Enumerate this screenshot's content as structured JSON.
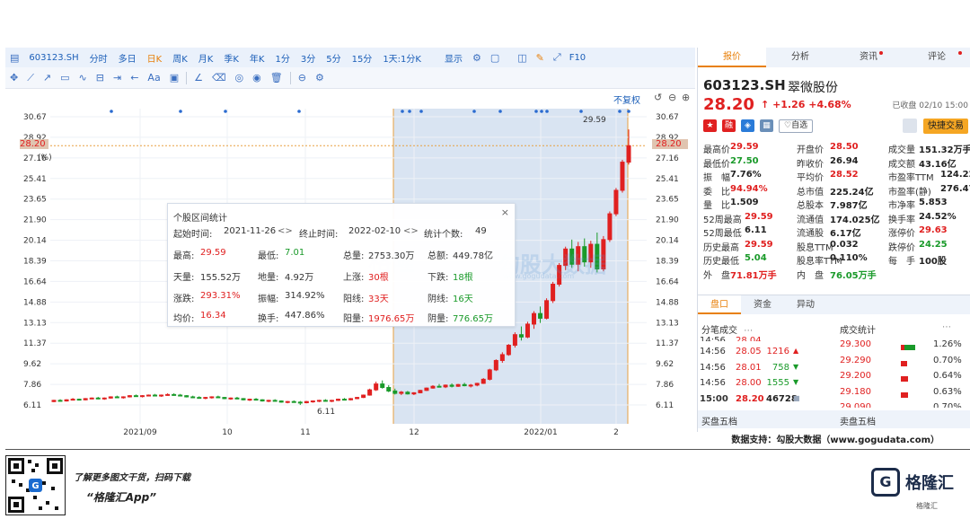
{
  "toolbar": {
    "code": "603123.SH",
    "periods": [
      "分时",
      "多日",
      "日K",
      "周K",
      "月K",
      "季K",
      "年K",
      "1分",
      "3分",
      "5分",
      "15分",
      "1天:1分K"
    ],
    "active_period": "日K",
    "display_label": "显示",
    "f10_label": "F10",
    "draw_tools": [
      "move",
      "line",
      "ray",
      "rect",
      "wave",
      "split",
      "arrow",
      "text",
      "note",
      "erase",
      "measure",
      "circle",
      "time",
      "delete",
      "pair",
      "settings"
    ]
  },
  "chart": {
    "adjust_label": "不复权",
    "y_ticks": [
      "30.67",
      "28.92",
      "27.16",
      "25.41",
      "23.65",
      "21.90",
      "20.14",
      "18.39",
      "16.64",
      "14.88",
      "13.13",
      "11.37",
      "9.62",
      "7.86",
      "6.11"
    ],
    "current_price_left": "28.20",
    "current_price_right": "28.20",
    "ma_label": "(%)",
    "max_label": "29.59",
    "min_label": "6.11",
    "x_labels": [
      "2021/09",
      "10",
      "11",
      "12",
      "2022/01",
      "2"
    ]
  },
  "chart_data": {
    "type": "candlestick",
    "title": "",
    "xlabel": "",
    "ylabel": "",
    "ylim": [
      6.11,
      30.67
    ],
    "x_ticks": [
      "2021/09",
      "10",
      "11",
      "12",
      "2022/01",
      "2"
    ],
    "series": [
      {
        "ohlc": [
          [
            6.4,
            6.55,
            6.35,
            6.5
          ],
          [
            6.5,
            6.6,
            6.4,
            6.45
          ],
          [
            6.45,
            6.6,
            6.4,
            6.55
          ],
          [
            6.55,
            6.7,
            6.5,
            6.6
          ],
          [
            6.6,
            6.65,
            6.5,
            6.55
          ],
          [
            6.55,
            6.7,
            6.5,
            6.65
          ],
          [
            6.65,
            6.75,
            6.6,
            6.7
          ],
          [
            6.7,
            6.8,
            6.6,
            6.65
          ],
          [
            6.65,
            6.75,
            6.55,
            6.7
          ],
          [
            6.7,
            6.85,
            6.65,
            6.8
          ],
          [
            6.8,
            6.9,
            6.7,
            6.75
          ],
          [
            6.75,
            6.85,
            6.65,
            6.8
          ],
          [
            6.8,
            6.95,
            6.75,
            6.9
          ],
          [
            6.9,
            7.0,
            6.8,
            6.85
          ],
          [
            6.85,
            6.95,
            6.75,
            6.9
          ],
          [
            6.9,
            7.0,
            6.85,
            6.95
          ],
          [
            6.95,
            7.05,
            6.85,
            6.9
          ],
          [
            6.9,
            7.0,
            6.8,
            6.95
          ],
          [
            6.95,
            7.1,
            6.9,
            7.0
          ],
          [
            7.0,
            7.1,
            6.9,
            6.95
          ],
          [
            6.95,
            7.05,
            6.85,
            6.9
          ],
          [
            6.9,
            6.95,
            6.75,
            6.8
          ],
          [
            6.8,
            6.9,
            6.7,
            6.75
          ],
          [
            6.75,
            6.85,
            6.65,
            6.7
          ],
          [
            6.7,
            6.8,
            6.6,
            6.75
          ],
          [
            6.75,
            6.85,
            6.65,
            6.8
          ],
          [
            6.8,
            6.9,
            6.7,
            6.75
          ],
          [
            6.75,
            6.8,
            6.6,
            6.65
          ],
          [
            6.65,
            6.75,
            6.55,
            6.7
          ],
          [
            6.7,
            6.8,
            6.6,
            6.65
          ],
          [
            6.65,
            6.7,
            6.5,
            6.55
          ],
          [
            6.55,
            6.65,
            6.45,
            6.6
          ],
          [
            6.6,
            6.7,
            6.5,
            6.55
          ],
          [
            6.55,
            6.6,
            6.4,
            6.45
          ],
          [
            6.45,
            6.55,
            6.35,
            6.5
          ],
          [
            6.5,
            6.6,
            6.4,
            6.45
          ],
          [
            6.45,
            6.5,
            6.3,
            6.35
          ],
          [
            6.35,
            6.45,
            6.25,
            6.4
          ],
          [
            6.4,
            6.5,
            6.3,
            6.35
          ],
          [
            6.35,
            6.45,
            6.11,
            6.3
          ],
          [
            6.3,
            6.45,
            6.25,
            6.4
          ],
          [
            6.4,
            6.5,
            6.3,
            6.45
          ],
          [
            6.45,
            6.55,
            6.35,
            6.5
          ],
          [
            6.5,
            6.6,
            6.4,
            6.45
          ],
          [
            6.45,
            6.55,
            6.35,
            6.5
          ],
          [
            6.5,
            6.65,
            6.45,
            6.6
          ],
          [
            6.6,
            6.7,
            6.5,
            6.55
          ],
          [
            6.55,
            6.7,
            6.5,
            6.65
          ],
          [
            6.65,
            6.8,
            6.6,
            6.75
          ],
          [
            6.75,
            7.0,
            6.7,
            6.95
          ],
          [
            6.95,
            7.5,
            6.9,
            7.4
          ],
          [
            7.4,
            8.1,
            7.3,
            7.9
          ],
          [
            7.9,
            8.2,
            7.5,
            7.6
          ],
          [
            7.6,
            7.8,
            7.2,
            7.3
          ],
          [
            7.3,
            7.5,
            7.0,
            7.1
          ],
          [
            7.1,
            7.3,
            6.95,
            7.2
          ],
          [
            7.2,
            7.3,
            7.0,
            7.05
          ],
          [
            7.05,
            7.2,
            6.95,
            7.15
          ],
          [
            7.15,
            7.4,
            7.1,
            7.35
          ],
          [
            7.35,
            7.6,
            7.3,
            7.55
          ],
          [
            7.55,
            7.8,
            7.5,
            7.7
          ],
          [
            7.7,
            7.9,
            7.6,
            7.65
          ],
          [
            7.65,
            7.85,
            7.55,
            7.8
          ],
          [
            7.8,
            7.95,
            7.6,
            7.7
          ],
          [
            7.7,
            7.9,
            7.65,
            7.85
          ],
          [
            7.85,
            8.0,
            7.7,
            7.75
          ],
          [
            7.75,
            7.9,
            7.6,
            7.8
          ],
          [
            7.8,
            8.0,
            7.7,
            7.95
          ],
          [
            7.95,
            8.4,
            7.9,
            8.3
          ],
          [
            8.3,
            9.2,
            8.2,
            9.1
          ],
          [
            9.1,
            10.0,
            9.0,
            9.9
          ],
          [
            9.9,
            10.6,
            9.7,
            10.4
          ],
          [
            10.4,
            11.3,
            10.3,
            11.2
          ],
          [
            11.2,
            12.3,
            11.0,
            12.1
          ],
          [
            12.1,
            12.8,
            11.6,
            11.9
          ],
          [
            11.9,
            13.2,
            11.8,
            13.0
          ],
          [
            13.0,
            14.1,
            12.6,
            13.9
          ],
          [
            13.9,
            14.5,
            13.1,
            13.5
          ],
          [
            13.5,
            15.2,
            13.4,
            15.0
          ],
          [
            15.0,
            16.6,
            14.8,
            16.4
          ],
          [
            16.4,
            18.2,
            16.2,
            18.0
          ],
          [
            18.0,
            19.6,
            17.6,
            19.4
          ],
          [
            19.4,
            20.2,
            17.8,
            18.1
          ],
          [
            18.1,
            20.0,
            17.5,
            19.6
          ],
          [
            19.6,
            20.3,
            17.9,
            18.3
          ],
          [
            18.3,
            20.1,
            17.8,
            19.8
          ],
          [
            19.8,
            20.8,
            17.4,
            17.7
          ],
          [
            17.7,
            20.5,
            17.5,
            20.2
          ],
          [
            20.2,
            22.6,
            20.0,
            22.4
          ],
          [
            22.4,
            24.6,
            22.2,
            24.4
          ],
          [
            24.4,
            27.0,
            24.2,
            26.8
          ],
          [
            26.8,
            29.59,
            26.6,
            28.2
          ]
        ]
      }
    ]
  },
  "stats": {
    "title": "个股区间统计",
    "start_label": "起始时间:",
    "start_value": "2021-11-26",
    "end_label": "终止时间:",
    "end_value": "2022-02-10",
    "count_label": "统计个数:",
    "count_value": "49",
    "high_label": "最高:",
    "high_value": "29.59",
    "low_label": "最低:",
    "low_value": "7.01",
    "vol_label": "总量:",
    "vol_value": "2753.30万",
    "amt_label": "总额:",
    "amt_value": "449.78亿",
    "sky_label": "天量:",
    "sky_value": "155.52万",
    "ground_label": "地量:",
    "ground_value": "4.92万",
    "up_label": "上涨:",
    "up_value": "30根",
    "down_label": "下跌:",
    "down_value": "18根",
    "pct_label": "涨跌:",
    "pct_value": "293.31%",
    "amp_label": "振幅:",
    "amp_value": "314.92%",
    "yang_label": "阳线:",
    "yang_value": "33天",
    "yin_label": "阴线:",
    "yin_value": "16天",
    "avg_label": "均价:",
    "avg_value": "16.34",
    "turn_label": "换手:",
    "turn_value": "447.86%",
    "yangvol_label": "阳量:",
    "yangvol_value": "1976.65万",
    "yinvol_label": "阴量:",
    "yinvol_value": "776.65万"
  },
  "watermark": {
    "brand1": "格隆",
    "brand2": "勾股大数据",
    "url": "www.gogudata.com"
  },
  "right_panel": {
    "tabs": [
      "报价",
      "分析",
      "资讯",
      "评论"
    ],
    "code": "603123.SH",
    "name": "翠微股份",
    "price": "28.20",
    "arrow": "↑",
    "change": "+1.26",
    "change_pct": "+4.68%",
    "closed_label": "已收盘 02/10 15:00",
    "fav_label": "♡自选",
    "quick_trade": "快捷交易",
    "quote_rows": [
      [
        "最高价",
        "29.59",
        "开盘价",
        "28.50",
        "成交量",
        "151.32万手"
      ],
      [
        "最低价",
        "27.50",
        "昨收价",
        "26.94",
        "成交额",
        "43.16亿"
      ],
      [
        "振　幅",
        "7.76%",
        "平均价",
        "28.52",
        "市盈率TTM",
        "124.229"
      ],
      [
        "委　比",
        "94.94%",
        "总市值",
        "225.24亿",
        "市盈率(静)",
        "276.470"
      ],
      [
        "量　比",
        "1.509",
        "总股本",
        "7.987亿",
        "市净率",
        "5.853"
      ],
      [
        "52周最高",
        "29.59",
        "流通值",
        "174.025亿",
        "换手率",
        "24.52%"
      ],
      [
        "52周最低",
        "6.11",
        "流通股",
        "6.17亿",
        "涨停价",
        "29.63"
      ],
      [
        "历史最高",
        "29.59",
        "股息TTM",
        "0.032",
        "跌停价",
        "24.25"
      ],
      [
        "历史最低",
        "5.04",
        "股息率TTM",
        "0.110%",
        "每　手",
        "100股"
      ],
      [
        "外　盘",
        "71.81万手",
        "内　盘",
        "76.05万手",
        "",
        ""
      ]
    ],
    "sub_tabs": [
      "盘口",
      "资金",
      "异动"
    ],
    "ticks_title": "分笔成交",
    "deal_title": "成交统计",
    "ticks": [
      [
        "14:56",
        "28.05",
        "1216",
        "▲"
      ],
      [
        "14:56",
        "28.01",
        "758",
        "▼"
      ],
      [
        "14:56",
        "28.00",
        "1555",
        "▼"
      ],
      [
        "15:00",
        "28.20",
        "46728",
        "■"
      ]
    ],
    "ticks_partial": [
      "14:56",
      "28.04",
      "",
      ""
    ],
    "deals": [
      [
        "29.300",
        "1.26%"
      ],
      [
        "29.290",
        "0.70%"
      ],
      [
        "29.200",
        "0.64%"
      ],
      [
        "29.180",
        "0.63%"
      ],
      [
        "29.090",
        "0.70%"
      ]
    ],
    "buy5": "买盘五档",
    "sell5": "卖盘五档"
  },
  "support": "数据支持：勾股大数据（www.gogudata.com）",
  "footer": {
    "learn": "了解更多图文干货，扫码下载",
    "app": "“格隆汇App”",
    "brand": "格隆汇",
    "brand_sub": "格隆汇"
  },
  "colors": {
    "up": "#e02020",
    "down": "#1a9a2a",
    "accent": "#e8800b",
    "link": "#1c5fb8",
    "selection": "#b9cde5"
  }
}
